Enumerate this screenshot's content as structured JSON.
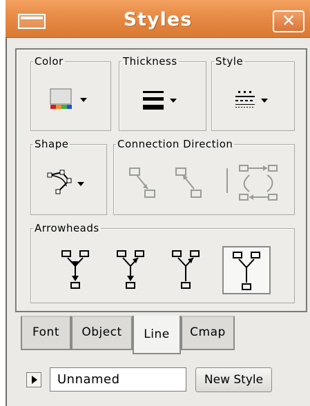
{
  "window": {
    "title": "Styles",
    "close_glyph": "✕"
  },
  "groups": {
    "color": "Color",
    "thickness": "Thickness",
    "style": "Style",
    "shape": "Shape",
    "connection_direction": "Connection Direction",
    "arrowheads": "Arrowheads"
  },
  "icons": {
    "color": "color-picker-icon",
    "thickness": "line-thickness-icon",
    "style": "line-style-icon",
    "shape": "line-shape-icon",
    "connection": [
      "connection-forward-icon",
      "connection-backward-icon",
      "connection-bidirectional-icon"
    ],
    "arrowheads": [
      "arrowhead-both-ends-icon",
      "arrowhead-top-icon",
      "arrowhead-bottom-icon",
      "arrowhead-none-icon"
    ]
  },
  "tabs": [
    {
      "label": "Font",
      "active": false
    },
    {
      "label": "Object",
      "active": false
    },
    {
      "label": "Line",
      "active": true
    },
    {
      "label": "Cmap",
      "active": false
    }
  ],
  "footer": {
    "style_name_value": "Unnamed",
    "new_style_label": "New Style"
  }
}
